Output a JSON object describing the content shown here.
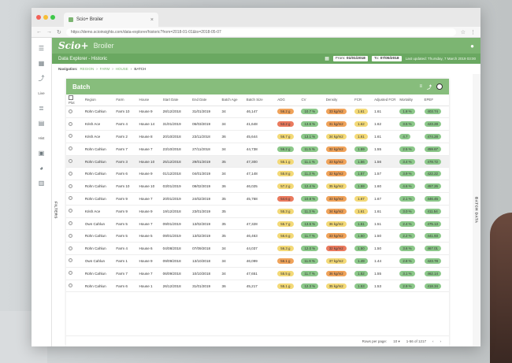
{
  "browser": {
    "tab_title": "Scio+ Broiler",
    "url": "https://demo.scioinsights.com/data-explorer/historic?from=2018-01-01&to=2018-05-07"
  },
  "colors": {
    "accent": "#7cb572",
    "accent_dark": "#6aa861",
    "good": "#8cc88a",
    "warn": "#f3d977",
    "alert": "#f0a35a",
    "bad": "#ea7a5e"
  },
  "sidebar": {
    "items": [
      {
        "icon": "menu-icon"
      },
      {
        "icon": "dashboard-icon"
      },
      {
        "icon": "trend-icon"
      },
      {
        "label": "Live"
      },
      {
        "icon": "list-icon"
      },
      {
        "icon": "calendar-icon"
      },
      {
        "label": "Hist"
      },
      {
        "icon": "image-icon"
      },
      {
        "icon": "pie-icon"
      },
      {
        "icon": "table-icon"
      }
    ]
  },
  "header": {
    "logo": "Scio+",
    "app_name": "Broiler"
  },
  "subheader": {
    "title": "Data Explorer - Historic",
    "from_label": "From",
    "from_value": "01/01/2018",
    "to_label": "To",
    "to_value": "07/05/2018",
    "updated": "Last updated: Thursday, 7 March 2019 03:00"
  },
  "breadcrumb": {
    "label": "Navigation:",
    "items": [
      "REGION",
      "FARM",
      "HOUSE",
      "BATCH"
    ]
  },
  "side_tabs": {
    "filters": "FILTERS",
    "right": "BATCH DATA"
  },
  "card": {
    "title": "Batch"
  },
  "table": {
    "columns": [
      "Plot",
      "Region",
      "Farm",
      "House",
      "Start Date",
      "End Date",
      "Batch Age",
      "Batch Size",
      "ADG",
      "CV",
      "Density",
      "FCR",
      "Adjusted FCR",
      "Mortality",
      "EPEF"
    ],
    "rows": [
      {
        "region": "Rohn Cahlun",
        "farm": "Farm 10",
        "house": "House 9",
        "start": "28/12/2018",
        "end": "31/01/2019",
        "age": "34",
        "size": "46,147",
        "adg": [
          "56.2 g",
          "orange"
        ],
        "cv": [
          "10.7 %",
          "green"
        ],
        "density": [
          "33 kg/m2",
          "orange"
        ],
        "fcr": [
          "1.61",
          "yellow"
        ],
        "afcr": "1.61",
        "mort": [
          "1.8 %",
          "green"
        ],
        "epef": [
          "403.74",
          "green"
        ]
      },
      {
        "region": "Krish Ace",
        "farm": "Farm 4",
        "house": "House 14",
        "start": "31/01/2019",
        "end": "06/03/2019",
        "age": "34",
        "size": "41,648",
        "adg": [
          "53.2 g",
          "red"
        ],
        "cv": [
          "13.6 %",
          "green"
        ],
        "density": [
          "31 kg/m2",
          "orange"
        ],
        "fcr": [
          "1.62",
          "yellow"
        ],
        "afcr": "1.62",
        "mort": [
          "3.5 %",
          "green"
        ],
        "epef": [
          "423.28",
          "green"
        ]
      },
      {
        "region": "Krish Ace",
        "farm": "Farm 2",
        "house": "House 8",
        "start": "20/10/2018",
        "end": "23/11/2018",
        "age": "36",
        "size": "45,644",
        "adg": [
          "56.7 g",
          "yellow"
        ],
        "cv": [
          "13.1 %",
          "green"
        ],
        "density": [
          "34 kg/m2",
          "yellow"
        ],
        "fcr": [
          "1.61",
          "yellow"
        ],
        "afcr": "1.61",
        "mort": [
          "4.7",
          "green"
        ],
        "epef": [
          "474.28",
          "green"
        ]
      },
      {
        "region": "Rohn Cahlun",
        "farm": "Farm 7",
        "house": "House 7",
        "start": "23/10/2018",
        "end": "27/11/2018",
        "age": "34",
        "size": "44,738",
        "adg": [
          "56.2 g",
          "green"
        ],
        "cv": [
          "11.5 %",
          "green"
        ],
        "density": [
          "32 kg/m2",
          "orange"
        ],
        "fcr": [
          "1.59",
          "green"
        ],
        "afcr": "1.55",
        "mort": [
          "2.5 %",
          "green"
        ],
        "epef": [
          "459.67",
          "green"
        ]
      },
      {
        "region": "Rohn Cahlun",
        "farm": "Farm 3",
        "house": "House 10",
        "start": "25/12/2018",
        "end": "29/01/2019",
        "age": "35",
        "size": "47,300",
        "adg": [
          "55.1 g",
          "yellow"
        ],
        "cv": [
          "11.1 %",
          "green"
        ],
        "density": [
          "33 kg/m2",
          "orange"
        ],
        "fcr": [
          "1.56",
          "green"
        ],
        "afcr": "1.56",
        "mort": [
          "3.4 %",
          "green"
        ],
        "epef": [
          "478.72",
          "green"
        ]
      },
      {
        "region": "Rohn Cahlun",
        "farm": "Farm 6",
        "house": "House 9",
        "start": "01/12/2018",
        "end": "04/01/2019",
        "age": "34",
        "size": "47,148",
        "adg": [
          "55.8 g",
          "yellow"
        ],
        "cv": [
          "11.3 %",
          "green"
        ],
        "density": [
          "32 kg/m2",
          "orange"
        ],
        "fcr": [
          "1.57",
          "green"
        ],
        "afcr": "1.57",
        "mort": [
          "3.9 %",
          "green"
        ],
        "epef": [
          "422.22",
          "green"
        ]
      },
      {
        "region": "Rohn Cahlun",
        "farm": "Farm 10",
        "house": "House 10",
        "start": "03/01/2019",
        "end": "08/02/2019",
        "age": "36",
        "size": "46,025",
        "adg": [
          "57.2 g",
          "yellow"
        ],
        "cv": [
          "12.4 %",
          "green"
        ],
        "density": [
          "35 kg/m2",
          "yellow"
        ],
        "fcr": [
          "1.59",
          "green"
        ],
        "afcr": "1.60",
        "mort": [
          "4.6 %",
          "green"
        ],
        "epef": [
          "457.26",
          "green"
        ]
      },
      {
        "region": "Rohn Cahlun",
        "farm": "Farm 9",
        "house": "House 7",
        "start": "20/01/2019",
        "end": "24/02/2019",
        "age": "35",
        "size": "45,768",
        "adg": [
          "54.6 g",
          "red"
        ],
        "cv": [
          "10.8 %",
          "green"
        ],
        "density": [
          "33 kg/m2",
          "orange"
        ],
        "fcr": [
          "1.67",
          "yellow"
        ],
        "afcr": "1.67",
        "mort": [
          "2.1 %",
          "green"
        ],
        "epef": [
          "446.45",
          "green"
        ]
      },
      {
        "region": "Krish Ace",
        "farm": "Farm 9",
        "house": "House 9",
        "start": "19/12/2018",
        "end": "23/01/2019",
        "age": "35",
        "size": "",
        "adg": [
          "55.3 g",
          "yellow"
        ],
        "cv": [
          "11.3 %",
          "green"
        ],
        "density": [
          "34 kg/m2",
          "orange"
        ],
        "fcr": [
          "1.61",
          "yellow"
        ],
        "afcr": "1.61",
        "mort": [
          "3.0 %",
          "green"
        ],
        "epef": [
          "411.54",
          "green"
        ]
      },
      {
        "region": "Own Cahlun",
        "farm": "Farm 5",
        "house": "House 7",
        "start": "09/01/2019",
        "end": "13/02/2019",
        "age": "35",
        "size": "47,328",
        "adg": [
          "55.7 g",
          "yellow"
        ],
        "cv": [
          "13.5 %",
          "green"
        ],
        "density": [
          "36 kg/m2",
          "yellow"
        ],
        "fcr": [
          "1.51",
          "green"
        ],
        "afcr": "1.51",
        "mort": [
          "2.4 %",
          "green"
        ],
        "epef": [
          "475.13",
          "green"
        ]
      },
      {
        "region": "Rohn Cahlun",
        "farm": "Farm 5",
        "house": "House 5",
        "start": "09/01/2019",
        "end": "13/02/2019",
        "age": "35",
        "size": "46,463",
        "adg": [
          "56.6 g",
          "yellow"
        ],
        "cv": [
          "11.7 %",
          "green"
        ],
        "density": [
          "33 kg/m2",
          "orange"
        ],
        "fcr": [
          "1.50",
          "green"
        ],
        "afcr": "1.50",
        "mort": [
          "2.2 %",
          "green"
        ],
        "epef": [
          "441.93",
          "green"
        ]
      },
      {
        "region": "Rohn Cahlun",
        "farm": "Farm 4",
        "house": "House 6",
        "start": "04/08/2018",
        "end": "07/09/2018",
        "age": "34",
        "size": "44,037",
        "adg": [
          "56.3 g",
          "yellow"
        ],
        "cv": [
          "12.0 %",
          "green"
        ],
        "density": [
          "32 kg/m2",
          "red"
        ],
        "fcr": [
          "1.50",
          "green"
        ],
        "afcr": "1.50",
        "mort": [
          "3.6 %",
          "green"
        ],
        "epef": [
          "467.01",
          "green"
        ]
      },
      {
        "region": "Own Cahlun",
        "farm": "Farm 1",
        "house": "House 9",
        "start": "09/09/2018",
        "end": "13/10/2018",
        "age": "34",
        "size": "46,099",
        "adg": [
          "56.1 g",
          "orange"
        ],
        "cv": [
          "11.9 %",
          "green"
        ],
        "density": [
          "37 kg/m2",
          "yellow"
        ],
        "fcr": [
          "1.49",
          "green"
        ],
        "afcr": "1.44",
        "mort": [
          "2.8 %",
          "green"
        ],
        "epef": [
          "423.78",
          "green"
        ]
      },
      {
        "region": "Rohn Cahlun",
        "farm": "Farm 7",
        "house": "House 7",
        "start": "06/09/2018",
        "end": "10/10/2018",
        "age": "34",
        "size": "47,651",
        "adg": [
          "55.5 g",
          "yellow"
        ],
        "cv": [
          "11.7 %",
          "green"
        ],
        "density": [
          "36 kg/m2",
          "orange"
        ],
        "fcr": [
          "1.52",
          "green"
        ],
        "afcr": "1.55",
        "mort": [
          "3.1 %",
          "green"
        ],
        "epef": [
          "462.14",
          "green"
        ]
      },
      {
        "region": "Rohn Cahlun",
        "farm": "Farm 6",
        "house": "House 1",
        "start": "26/12/2018",
        "end": "31/01/2019",
        "age": "36",
        "size": "45,217",
        "adg": [
          "55.1 g",
          "yellow"
        ],
        "cv": [
          "12.3 %",
          "green"
        ],
        "density": [
          "35 kg/m2",
          "yellow"
        ],
        "fcr": [
          "1.53",
          "green"
        ],
        "afcr": "1.53",
        "mort": [
          "2.9 %",
          "green"
        ],
        "epef": [
          "418.34",
          "green"
        ]
      },
      {
        "region": "Own Cahlun",
        "farm": "Farm 5",
        "house": "House 10",
        "start": "08/10/2018",
        "end": "12/11/2018",
        "age": "35",
        "size": "42,293",
        "adg": [
          "58.8 g",
          "yellow"
        ],
        "cv": [
          "11.8 %",
          "green"
        ],
        "density": [
          "33 kg/m2",
          "yellow"
        ],
        "fcr": [
          "1.55",
          "green"
        ],
        "afcr": "1.55",
        "mort": [
          "3.2 %",
          "green"
        ],
        "epef": [
          "409.50",
          "green"
        ]
      }
    ]
  },
  "footer": {
    "rows_per_page_label": "Rows per page:",
    "rows_per_page": "10",
    "range": "1-56 of 1217"
  }
}
